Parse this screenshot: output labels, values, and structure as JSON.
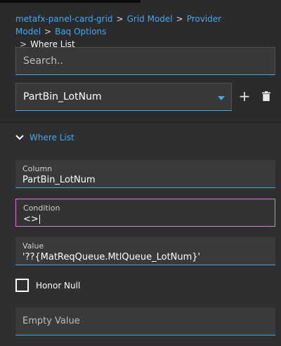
{
  "breadcrumb": {
    "items": [
      "metafx-panel-card-grid",
      "Grid Model",
      "Provider Model",
      "Baq Options"
    ],
    "separator": ">",
    "current": "Where List"
  },
  "search": {
    "placeholder": "Search..",
    "value": ""
  },
  "selector": {
    "value": "PartBin_LotNum",
    "add_icon": "plus-icon",
    "delete_icon": "trash-icon"
  },
  "section": {
    "title": "Where List",
    "expanded": true,
    "icon": "chevron-down-icon"
  },
  "fields": {
    "column": {
      "label": "Column",
      "value": "PartBin_LotNum"
    },
    "condition": {
      "label": "Condition",
      "value": "<>"
    },
    "value": {
      "label": "Value",
      "value": "'??{MatReqQueue.MtlQueue_LotNum}'"
    },
    "honor_null": {
      "label": "Honor Null",
      "checked": false
    },
    "empty_value": {
      "placeholder": "Empty Value",
      "value": ""
    }
  },
  "colors": {
    "accent": "#3fa9f5",
    "focus_border": "#d47ad0",
    "background": "#2b2b2b"
  }
}
